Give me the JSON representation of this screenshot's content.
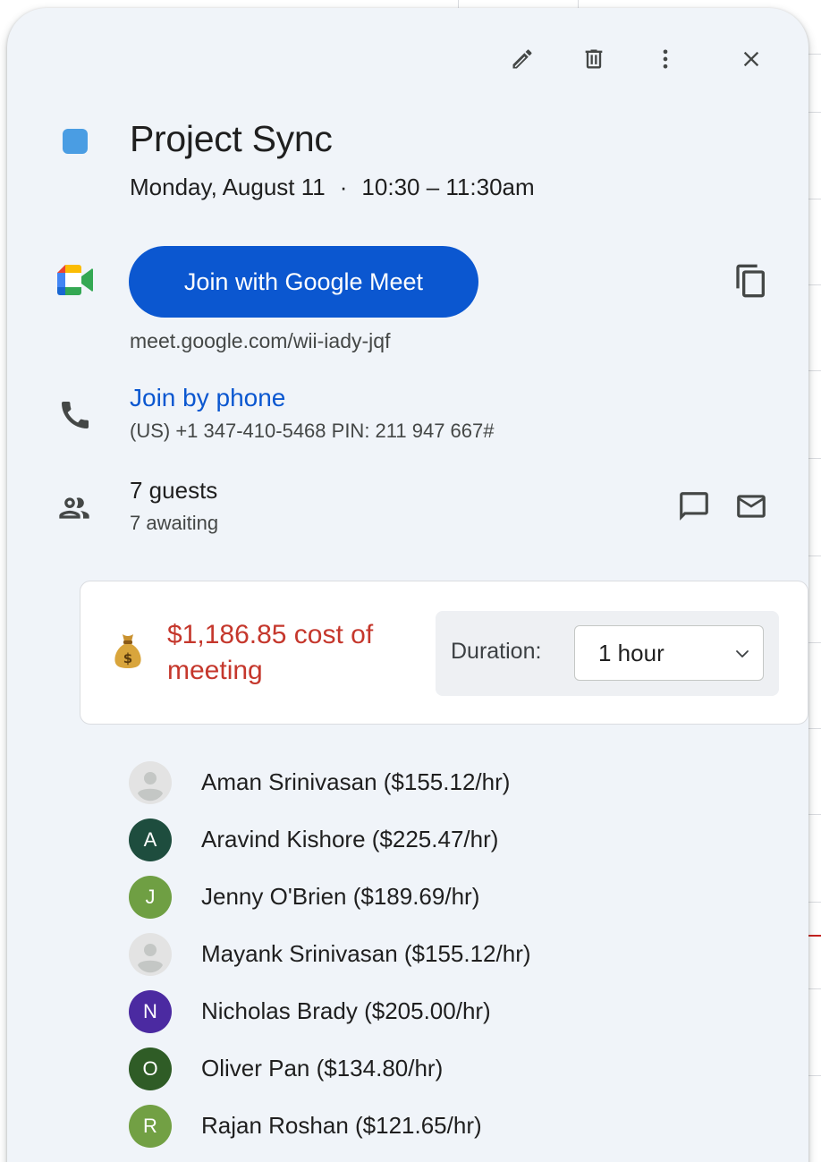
{
  "event": {
    "title": "Project Sync",
    "date": "Monday, August 11",
    "separator": "·",
    "time": "10:30 – 11:30am",
    "color": "#4a9de3"
  },
  "toolbar": {
    "edit_icon": "pencil-icon",
    "delete_icon": "trash-icon",
    "more_icon": "more-vert-icon",
    "close_icon": "close-icon"
  },
  "meet": {
    "join_label": "Join with Google Meet",
    "link": "meet.google.com/wii-iady-jqf",
    "copy_icon": "copy-icon",
    "button_color": "#0b57d0"
  },
  "phone": {
    "join_label": "Join by phone",
    "details": "(US) +1 347-410-5468 PIN: 211 947 667#"
  },
  "guests": {
    "count_label": "7 guests",
    "awaiting_label": "7 awaiting"
  },
  "cost": {
    "text": "$1,186.85 cost of meeting",
    "color": "#c5372c",
    "duration_label": "Duration:",
    "duration_value": "1 hour",
    "duration_options_visible": [
      "1 hour"
    ]
  },
  "guest_list": [
    {
      "initial": "",
      "name": "Aman Srinivasan ($155.12/hr)",
      "avatar_color": "#e3e3e3",
      "default_avatar": true
    },
    {
      "initial": "A",
      "name": "Aravind Kishore ($225.47/hr)",
      "avatar_color": "#1e4d3e",
      "default_avatar": false
    },
    {
      "initial": "J",
      "name": "Jenny O'Brien ($189.69/hr)",
      "avatar_color": "#6f9f43",
      "default_avatar": false
    },
    {
      "initial": "",
      "name": "Mayank Srinivasan ($155.12/hr)",
      "avatar_color": "#e3e3e3",
      "default_avatar": true
    },
    {
      "initial": "N",
      "name": "Nicholas Brady ($205.00/hr)",
      "avatar_color": "#4b2aa1",
      "default_avatar": false
    },
    {
      "initial": "O",
      "name": "Oliver Pan ($134.80/hr)",
      "avatar_color": "#2f5c26",
      "default_avatar": false
    },
    {
      "initial": "R",
      "name": "Rajan Roshan ($121.65/hr)",
      "avatar_color": "#72a044",
      "default_avatar": false
    }
  ]
}
